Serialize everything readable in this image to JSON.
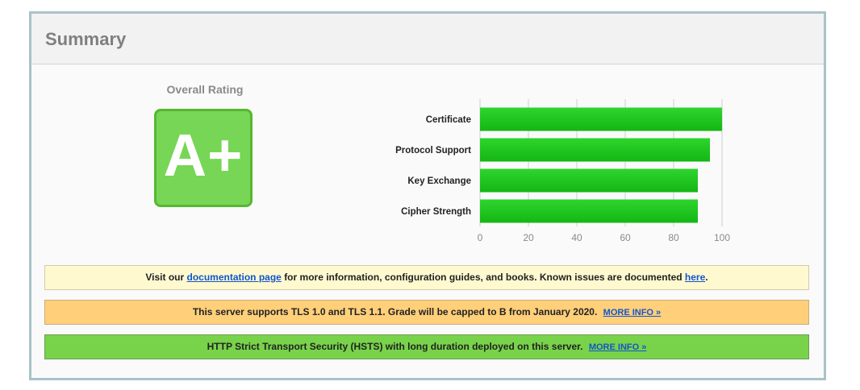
{
  "panel": {
    "title": "Summary"
  },
  "rating": {
    "label": "Overall Rating",
    "grade": "A+",
    "grade_color": "#77d655"
  },
  "chart_data": {
    "type": "bar",
    "orientation": "horizontal",
    "categories": [
      "Certificate",
      "Protocol Support",
      "Key Exchange",
      "Cipher Strength"
    ],
    "values": [
      100,
      95,
      90,
      90
    ],
    "xlim": [
      0,
      100
    ],
    "xticks": [
      0,
      20,
      40,
      60,
      80,
      100
    ],
    "grid": true,
    "bar_color": "#13b613"
  },
  "notices": {
    "info": {
      "prefix": "Visit our",
      "link1": "documentation page",
      "middle": "for more information, configuration guides, and books. Known issues are documented",
      "link2": "here",
      "suffix": "."
    },
    "warn": {
      "text": "This server supports TLS 1.0 and TLS 1.1. Grade will be capped to B from January 2020.",
      "more": "MORE INFO »"
    },
    "ok": {
      "text": "HTTP Strict Transport Security (HSTS) with long duration deployed on this server.",
      "more": "MORE INFO »"
    }
  }
}
